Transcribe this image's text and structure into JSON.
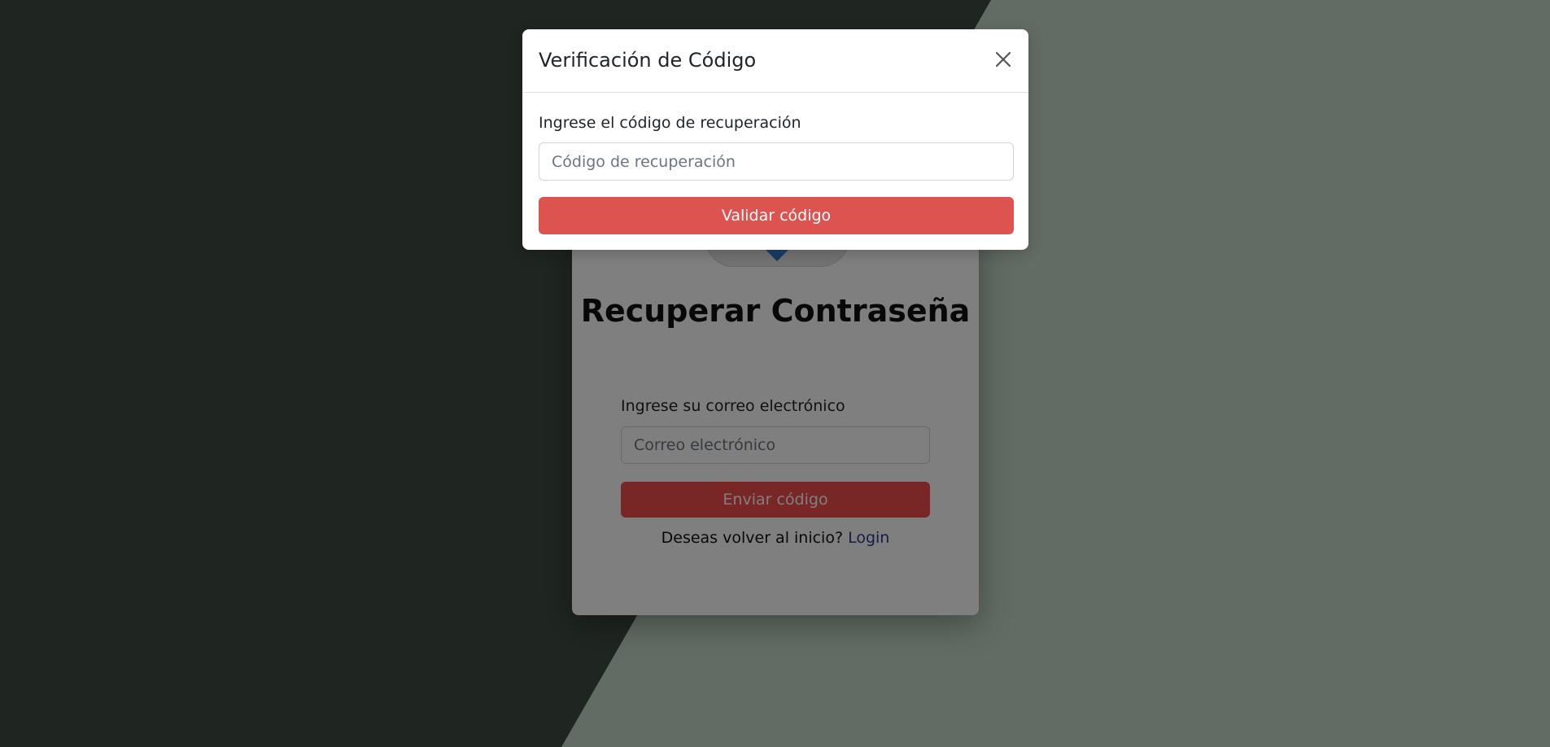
{
  "modal": {
    "title": "Verificación de Código",
    "field_label": "Ingrese el código de recuperación",
    "field_placeholder": "Código de recuperación",
    "field_value": "",
    "submit_label": "Validar código"
  },
  "background_page": {
    "title": "Recuperar Contraseña",
    "email_label": "Ingrese su correo electrónico",
    "email_placeholder": "Correo electrónico",
    "send_button_label": "Enviar código",
    "footer_text": "Deseas volver al inicio?",
    "login_link_label": "Login"
  },
  "icons": {
    "close": "close-icon",
    "logo": "shield-icon"
  },
  "colors": {
    "primary_button": "#dc5350",
    "backdrop": "rgba(0,0,0,0.5)",
    "link": "#2a3a8a"
  }
}
